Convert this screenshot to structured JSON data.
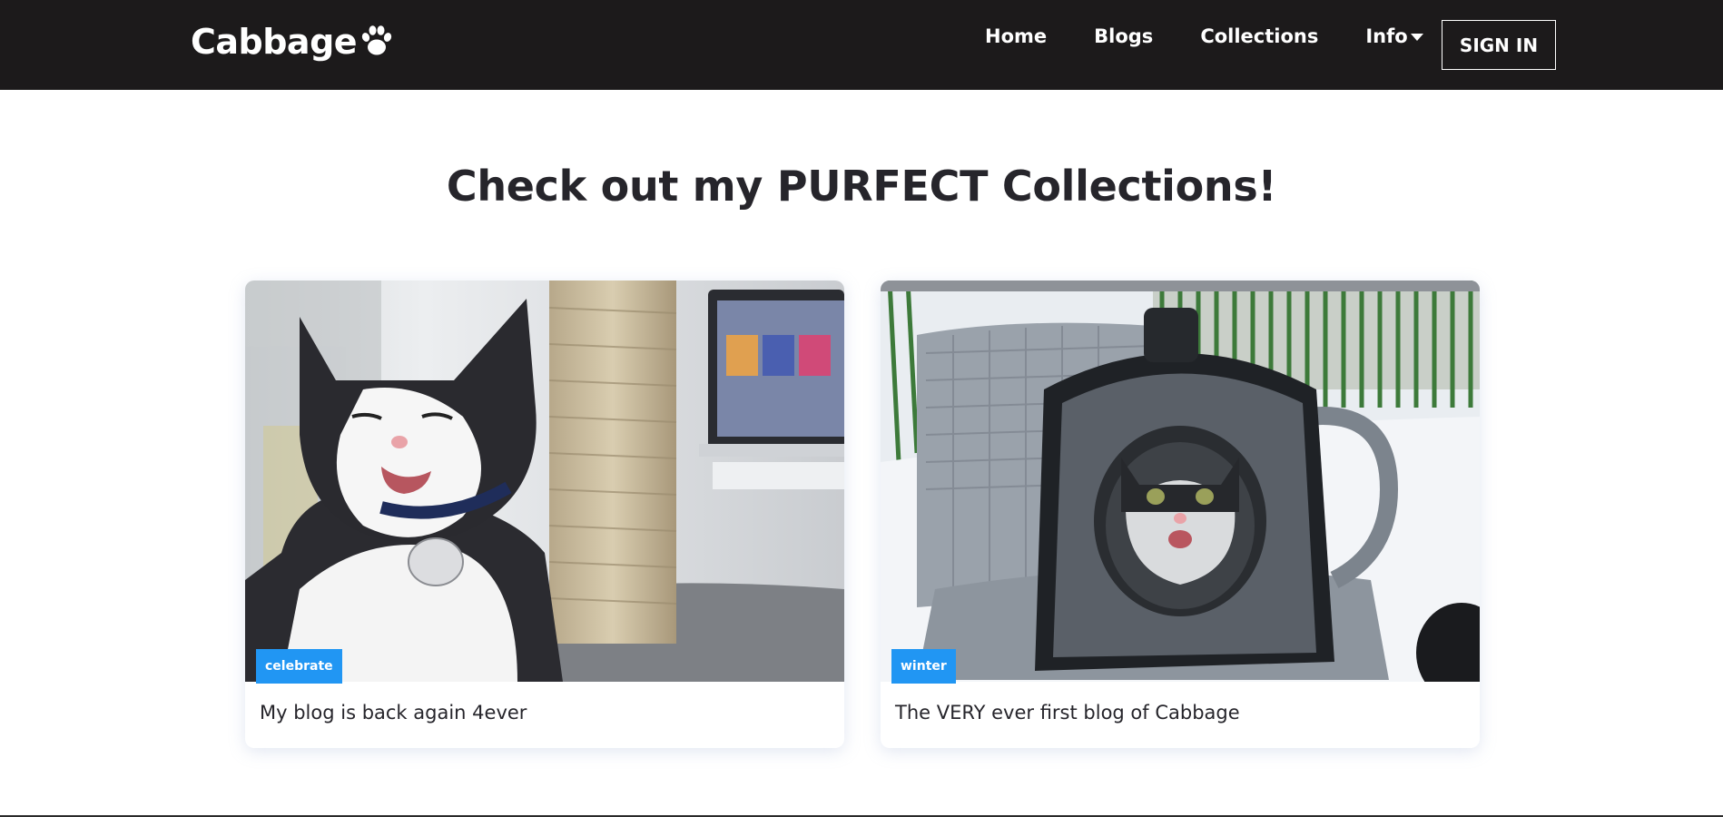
{
  "header": {
    "brand": "Cabbage",
    "brand_icon": "paw-icon",
    "nav": [
      {
        "label": "Home"
      },
      {
        "label": "Blogs"
      },
      {
        "label": "Collections"
      },
      {
        "label": "Info",
        "icon": "caret-down-icon"
      }
    ],
    "signin_label": "SIGN IN"
  },
  "main": {
    "heading": "Check out my PURFECT Collections!",
    "cards": [
      {
        "tag": "celebrate",
        "title": "My blog is back again 4ever",
        "image": "cat-with-scratching-post-photo"
      },
      {
        "tag": "winter",
        "title": "The VERY ever first blog of Cabbage",
        "image": "cat-in-carrier-snow-photo"
      }
    ]
  },
  "colors": {
    "navbar_bg": "#1c1a1b",
    "tag_bg": "#2196f3",
    "text_dark": "#26252b"
  }
}
